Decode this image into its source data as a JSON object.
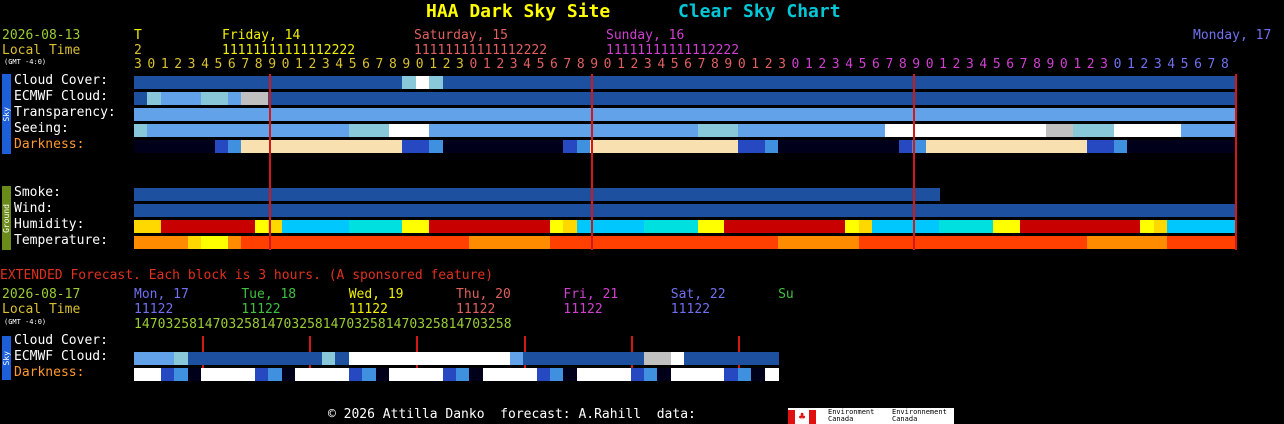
{
  "header": {
    "site_title": "HAA Dark Sky Site",
    "chart_title": "Clear Sky Chart"
  },
  "colors": {
    "title_yellow": "#ffff00",
    "title_cyan": "#00c8d8",
    "date_green": "#9acd32",
    "local_time": "#d8c030",
    "red_line": "#d41818",
    "darkness_label": "#ff9a30",
    "extended_red": "#e03020",
    "sky_tab": "#1d5fd8",
    "ground_tab": "#6a8a1a"
  },
  "timeline": {
    "date": "2026-08-13",
    "local_time_label": "Local Time",
    "gmt_offset": "(GMT -4:0)",
    "day_labels": [
      {
        "text": "T",
        "col": 0,
        "color": "#f0f000",
        "digits_color": "#d8c030",
        "digits": "2"
      },
      {
        "text": "Friday, 14",
        "col": 11,
        "color": "#f0f000",
        "digits_color": "#f0f000",
        "digits": "11111111111112222"
      },
      {
        "text": "Saturday, 15",
        "col": 35,
        "color": "#e06060",
        "digits_color": "#e06060",
        "digits": "11111111111112222"
      },
      {
        "text": "Sunday, 16",
        "col": 59,
        "color": "#d040d0",
        "digits_color": "#d040d0",
        "digits": "11111111111112222"
      },
      {
        "text": "Monday, 17",
        "col": 76,
        "color": "#7070f0",
        "digits_color": "#7070f0",
        "digits": ""
      }
    ],
    "hour_segments": [
      {
        "text": "3012345678901234567890123",
        "col": 0,
        "color": "#d8c030"
      },
      {
        "text": "012345678901234567890123",
        "col": 25,
        "color": "#e06060"
      },
      {
        "text": "012345678901234567890123",
        "col": 49,
        "color": "#d040d0"
      },
      {
        "text": "012345678",
        "col": 73,
        "color": "#7070f0"
      }
    ],
    "tens_start_cols": [
      11,
      35,
      59
    ]
  },
  "sky_rows": {
    "labels": [
      "Cloud Cover:",
      "ECMWF Cloud:",
      "Transparency:",
      "Seeing:",
      "Darkness:"
    ],
    "side_label": "Sky",
    "palette": {
      "A": "#0e3a8c",
      "B": "#1e50a0",
      "C": "#3a78c8",
      "D": "#62a2e8",
      "E": "#88c8d8",
      "W": "#ffffff",
      "G": "#c0c0c0",
      "N": "#00001a",
      "M": "#000080",
      "X": "#2648c0",
      "Y": "#4090e0",
      "F": "#f8e0b0"
    },
    "rows": [
      "BBBBBBBBBBBBBBBBBBBBEWEBBBBBBBBBBBBBBBBBBBBBBBBBBBBBBBBBBBBBBBBBBBBBBBBBBBBBBBBBBBBBBBBBBBBBBBBBBBBBBBBBBBBBBBBBBBBBBBBBBB",
      "BEDDDEEDGGBBBBBBBBBBBBBBBBBBBBBBBBBBBBBBBBBBBBBBBBBBBBBBBBBBBBBBBBBBBBBBBBBBBBBBBBBBBBBBBBBBBBBBBBBBBBBBBBBBBBBBBBBBBBBBBBBB",
      "DDDDDDDDDDDDDDDDDDDDDDDDDDDDDDDDDDDDDDDDDDDDDDDDDDDDDDDDDDDDDDDDDDDDDDDDDDDDDDDDDDDDDDDDDDDDDDDDDDDDDDDDDDDDDDDDDDDDDDDDDD",
      "EDDDDDDDDDDDDDDDEEEWWWDDDDDDDDDDDDDDDDDDDDEEEDDDDDDDDDDDWWWWWWWWWWWWGGEEEWWWWWDDDDDDDDDDDDDDDDDDDDDDDDDDDDDDDDDDDDDDDDDDDDDD",
      "NNNNNNXYFFFFFFFFFFFFXXYNNNNNNNNNXYFFFFFFFFFFFXXYNNNNNNNNNXYFFFFFFFFFFFFXXYNNNNNNNNNXYFFFFFFFFFFFFXXYNNNNNNNNNNNNNNNNNNNNNNNNNN"
    ]
  },
  "ground_rows": {
    "labels": [
      "Smoke:",
      "Wind:",
      "Humidity:",
      "Temperature:"
    ],
    "side_label": "Ground",
    "palette": {
      "A": "#0e3a8c",
      "B": "#1e50a0",
      "C": "#3a78c8",
      "D": "#62a2e8",
      "E": "#88c8d8",
      "H": "#c80000",
      "I": "#ff4000",
      "J": "#ff8c00",
      "K": "#ffd800",
      "L": "#00e0e0",
      "P": "#70d0c0",
      "Q": "#00c8ff",
      "R": "#ffff00",
      "S": "#e83000",
      "T": "#ff6a00"
    },
    "smoke_len": 60,
    "rows": [
      "BBBBBBBBBBBBBBBBBBBBBBBBBBBBBBBBBBBBBBBBBBBBBBBBBBBBBBBBBBBB",
      "BBBBBBBBBBBBBBBBBBBBBBBBBBBBBBBBBBBBBBBBBBBBBBBBBBBBBBBBBBBBBBBBBBBBBBBBBBBBBBBBBBBBBBBBBBBBBBBBBBBBBBBBBBBBBBBBBBBBBBBBBB",
      "KKHHHHHHHRKQQQQQLLLLRRHHHHHHHHHRKQQQQQLLLLRRHHHHHHHHHRKQQQQQLLLLRRHHHHHHHHHRKQQQQQLLLLRRHHHHHHHHHHHHHHHHHHHHHHHHHHHHHHHHHHHH",
      "JJJJKRRJIIIIIIIIIIIIIIIIIJJJJJJIIIIIIIIIIIIIIIIIJJJJJJIIIIIIIIIIIIIIIIIJJJJJJIIIIIIIIIIIIIIIIIJJJJJJJJJJJJJJJJJJJJJJJJJJJJJJJ"
    ]
  },
  "extended": {
    "banner": "EXTENDED Forecast. Each block is 3 hours. (A sponsored feature)",
    "date": "2026-08-17",
    "local_time_label": "Local Time",
    "gmt_offset": "(GMT -4:0)",
    "days": [
      {
        "text": "Mon, 17",
        "col": 0,
        "color": "#7070f0",
        "digits": "11122"
      },
      {
        "text": "Tue, 18",
        "col": 8,
        "color": "#40c040",
        "digits": "11122"
      },
      {
        "text": "Wed, 19",
        "col": 16,
        "color": "#f0f000",
        "digits": "11122"
      },
      {
        "text": "Thu, 20",
        "col": 24,
        "color": "#e06060",
        "digits": "11122"
      },
      {
        "text": "Fri, 21",
        "col": 32,
        "color": "#d040d0",
        "digits": "11122"
      },
      {
        "text": "Sat, 22",
        "col": 40,
        "color": "#7070f0",
        "digits": "11122"
      },
      {
        "text": "Su",
        "col": 48,
        "color": "#40c040",
        "digits": ""
      }
    ],
    "hours": "147032581470325814703258147032581470325814703258",
    "hours_color": "#9acd32",
    "labels": [
      "Cloud Cover:",
      "ECMWF Cloud:",
      "Darkness:"
    ],
    "side_label": "Sky",
    "cloud_row": "",
    "ecmwf_row": "DDDEBBBBBBBBBBEBWWWWWWWWWWWWDBBBBBBBBBGGWBBBBBBBBBEBE",
    "darkness_row": "WWXYNWWWWXYNWWWWXYNWWWWXYNWWWWXYNWWWWXYNWWWWXYNWWW"
  },
  "footer": {
    "text": "© 2026 Attilla Danko  forecast: A.Rahill  data:",
    "flag_label_en": "Environment Canada",
    "flag_label_fr": "Environnement Canada"
  }
}
